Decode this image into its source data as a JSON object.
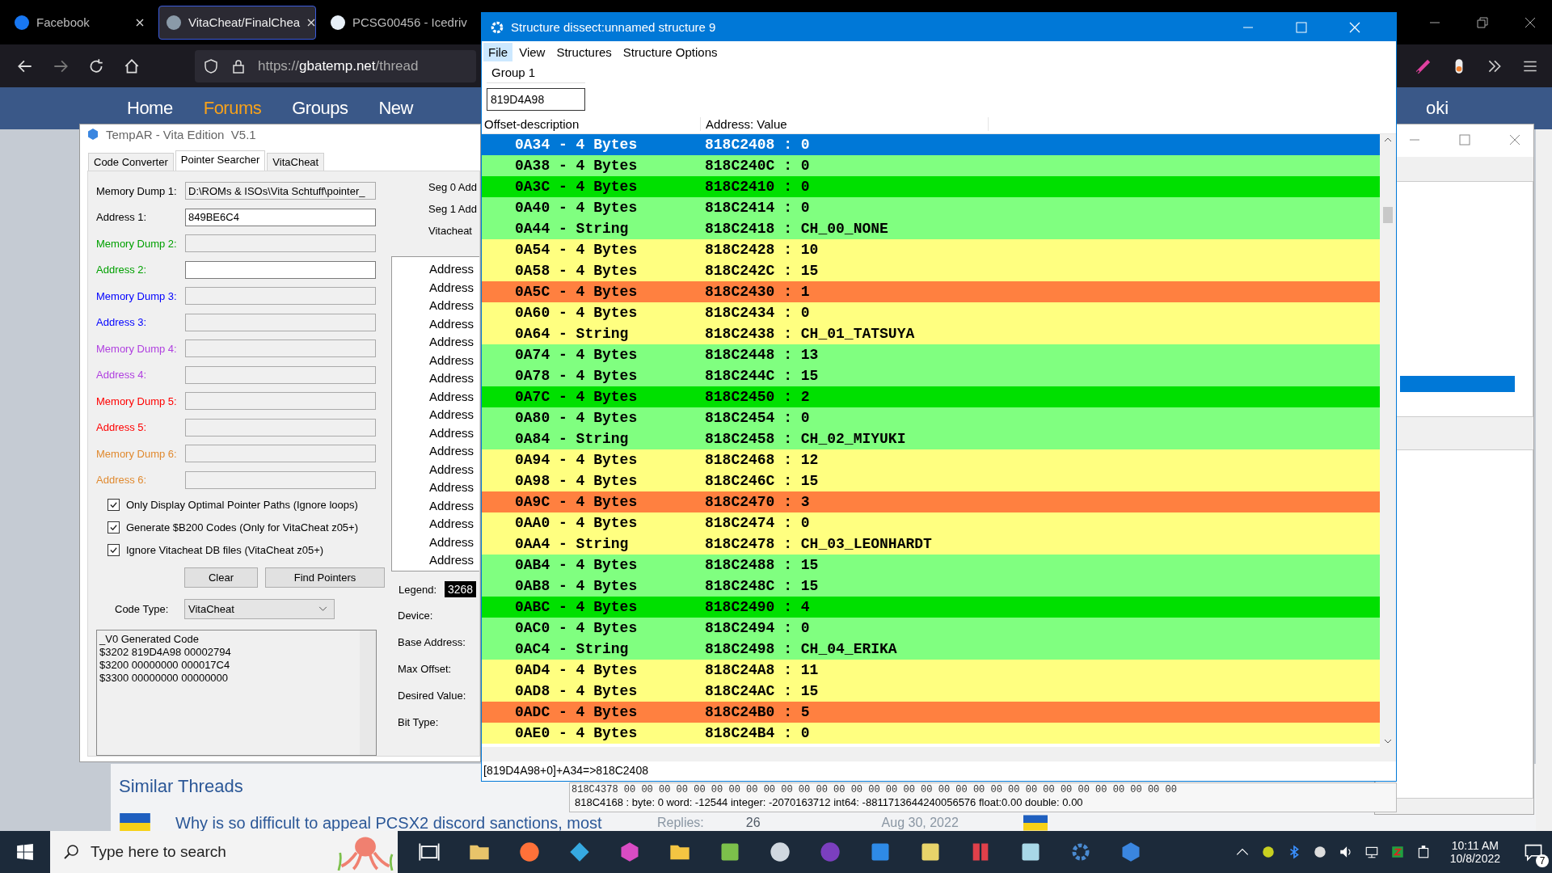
{
  "browser": {
    "tabs": [
      {
        "title": "Facebook",
        "selected": false
      },
      {
        "title": "VitaCheat/FinalChea",
        "selected": true
      },
      {
        "title": "PCSG00456 - Icedriv",
        "selected": false
      }
    ],
    "url_scheme": "https://",
    "url_host": "gbatemp.net",
    "url_path": "/thread",
    "nav": [
      {
        "label": "Home",
        "selected": false
      },
      {
        "label": "Forums",
        "selected": true
      },
      {
        "label": "Groups",
        "selected": false
      },
      {
        "label": "New",
        "selected": false
      }
    ],
    "nav_cut": "oki",
    "similar_title": "Similar Threads",
    "thread_title": "Why is so difficult to appeal PCSX2 discord sanctions, most",
    "replies_label": "Replies:",
    "replies": "26",
    "date": "Aug 30, 2022"
  },
  "tempar": {
    "title": "TempAR - Vita Edition  V5.1",
    "tabs": [
      {
        "label": "Code Converter",
        "selected": false
      },
      {
        "label": "Pointer Searcher",
        "selected": true
      },
      {
        "label": "VitaCheat",
        "selected": false
      }
    ],
    "fields": [
      {
        "label": "Memory Dump 1:",
        "value": "D:\\ROMs & ISOs\\Vita Schtuff\\pointer_",
        "enabled": false,
        "color": "#000000"
      },
      {
        "label": "Address 1:",
        "value": "849BE6C4",
        "enabled": true,
        "color": "#000000"
      },
      {
        "label": "Memory Dump 2:",
        "enabled": false,
        "color": "#00a000"
      },
      {
        "label": "Address 2:",
        "enabled": true,
        "color": "#00a000"
      },
      {
        "label": "Memory Dump 3:",
        "enabled": false,
        "color": "#0000ff"
      },
      {
        "label": "Address 3:",
        "enabled": false,
        "color": "#0000ff"
      },
      {
        "label": "Memory Dump 4:",
        "enabled": false,
        "color": "#b040e0"
      },
      {
        "label": "Address 4:",
        "enabled": false,
        "color": "#b040e0"
      },
      {
        "label": "Memory Dump 5:",
        "enabled": false,
        "color": "#ff0000"
      },
      {
        "label": "Address 5:",
        "enabled": false,
        "color": "#ff0000"
      },
      {
        "label": "Memory Dump 6:",
        "enabled": false,
        "color": "#e08a30"
      },
      {
        "label": "Address 6:",
        "enabled": false,
        "color": "#e08a30"
      }
    ],
    "options": [
      {
        "label": "Only Display Optimal Pointer Paths (Ignore loops)",
        "checked": true
      },
      {
        "label": "Generate $B200 Codes (Only for VitaCheat z05+)",
        "checked": true
      },
      {
        "label": "Ignore Vitacheat DB files (VitaCheat z05+)",
        "checked": true
      }
    ],
    "buttons": [
      "Clear",
      "Find Pointers"
    ],
    "code_type_label": "Code Type:",
    "code_type": "VitaCheat",
    "code_lines": [
      "_V0 Generated Code",
      "$3202 819D4A98 00002794",
      "$3200 00000000 000017C4",
      "$3300 00000000 00000000"
    ],
    "seg_labels": [
      "Seg 0 Add",
      "Seg 1 Add",
      "Vitacheat"
    ],
    "tree_items": [
      "Address",
      "Address",
      "Address",
      "Address",
      "Address",
      "Address",
      "Address",
      "Address",
      "Address",
      "Address",
      "Address",
      "Address",
      "Address",
      "Address",
      "Address",
      "Address",
      "Address"
    ],
    "legend_label": "Legend:",
    "legend_value": "3268",
    "settings": [
      "Device:",
      "Base Address:",
      "Max Offset:",
      "Desired Value:",
      "Bit Type:"
    ]
  },
  "dissect": {
    "title": "Structure dissect:unnamed structure 9",
    "menu": [
      {
        "label": "File",
        "selected": true
      },
      {
        "label": "View",
        "selected": false
      },
      {
        "label": "Structures",
        "selected": false
      },
      {
        "label": "Structure Options",
        "selected": false
      }
    ],
    "group_label": "Group 1",
    "group_address": "819D4A98",
    "columns": [
      "Offset-description",
      "Address: Value"
    ],
    "rows": [
      {
        "offset": "0A34 - 4 Bytes",
        "address_value": "818C2408 : 0",
        "selected": true
      },
      {
        "offset": "0A38 - 4 Bytes",
        "address_value": "818C240C : 0",
        "selected": false,
        "color": "#80ff80"
      },
      {
        "offset": "0A3C - 4 Bytes",
        "address_value": "818C2410 : 0",
        "selected": false,
        "color": "#00e000"
      },
      {
        "offset": "0A40 - 4 Bytes",
        "address_value": "818C2414 : 0",
        "selected": false,
        "color": "#80ff80"
      },
      {
        "offset": "0A44 - String",
        "address_value": "818C2418 : CH_00_NONE",
        "selected": false,
        "color": "#80ff80"
      },
      {
        "offset": "0A54 - 4 Bytes",
        "address_value": "818C2428 : 10",
        "selected": false,
        "color": "#ffff80"
      },
      {
        "offset": "0A58 - 4 Bytes",
        "address_value": "818C242C : 15",
        "selected": false,
        "color": "#ffff80"
      },
      {
        "offset": "0A5C - 4 Bytes",
        "address_value": "818C2430 : 1",
        "selected": false,
        "color": "#ff8040"
      },
      {
        "offset": "0A60 - 4 Bytes",
        "address_value": "818C2434 : 0",
        "selected": false,
        "color": "#ffff80"
      },
      {
        "offset": "0A64 - String",
        "address_value": "818C2438 : CH_01_TATSUYA",
        "selected": false,
        "color": "#ffff80"
      },
      {
        "offset": "0A74 - 4 Bytes",
        "address_value": "818C2448 : 13",
        "selected": false,
        "color": "#80ff80"
      },
      {
        "offset": "0A78 - 4 Bytes",
        "address_value": "818C244C : 15",
        "selected": false,
        "color": "#80ff80"
      },
      {
        "offset": "0A7C - 4 Bytes",
        "address_value": "818C2450 : 2",
        "selected": false,
        "color": "#00e000"
      },
      {
        "offset": "0A80 - 4 Bytes",
        "address_value": "818C2454 : 0",
        "selected": false,
        "color": "#80ff80"
      },
      {
        "offset": "0A84 - String",
        "address_value": "818C2458 : CH_02_MIYUKI",
        "selected": false,
        "color": "#80ff80"
      },
      {
        "offset": "0A94 - 4 Bytes",
        "address_value": "818C2468 : 12",
        "selected": false,
        "color": "#ffff80"
      },
      {
        "offset": "0A98 - 4 Bytes",
        "address_value": "818C246C : 15",
        "selected": false,
        "color": "#ffff80"
      },
      {
        "offset": "0A9C - 4 Bytes",
        "address_value": "818C2470 : 3",
        "selected": false,
        "color": "#ff8040"
      },
      {
        "offset": "0AA0 - 4 Bytes",
        "address_value": "818C2474 : 0",
        "selected": false,
        "color": "#ffff80"
      },
      {
        "offset": "0AA4 - String",
        "address_value": "818C2478 : CH_03_LEONHARDT",
        "selected": false,
        "color": "#ffff80"
      },
      {
        "offset": "0AB4 - 4 Bytes",
        "address_value": "818C2488 : 15",
        "selected": false,
        "color": "#80ff80"
      },
      {
        "offset": "0AB8 - 4 Bytes",
        "address_value": "818C248C : 15",
        "selected": false,
        "color": "#80ff80"
      },
      {
        "offset": "0ABC - 4 Bytes",
        "address_value": "818C2490 : 4",
        "selected": false,
        "color": "#00e000"
      },
      {
        "offset": "0AC0 - 4 Bytes",
        "address_value": "818C2494 : 0",
        "selected": false,
        "color": "#80ff80"
      },
      {
        "offset": "0AC4 - String",
        "address_value": "818C2498 : CH_04_ERIKA",
        "selected": false,
        "color": "#80ff80"
      },
      {
        "offset": "0AD4 - 4 Bytes",
        "address_value": "818C24A8 : 11",
        "selected": false,
        "color": "#ffff80"
      },
      {
        "offset": "0AD8 - 4 Bytes",
        "address_value": "818C24AC : 15",
        "selected": false,
        "color": "#ffff80"
      },
      {
        "offset": "0ADC - 4 Bytes",
        "address_value": "818C24B0 : 5",
        "selected": false,
        "color": "#ff8040"
      },
      {
        "offset": "0AE0 - 4 Bytes",
        "address_value": "818C24B4 : 0",
        "selected": false,
        "color": "#ffff80"
      }
    ],
    "status": "[819D4A98+0]+A34=>818C2408"
  },
  "memory_view": {
    "hex_line": "818C4378  00 00 00 00 00 00 00 00 00 00 00 00 00 00 00 00  00 00 00 00 00 00 00 00 00 00 00 00 00 00 00 00",
    "status": "818C4168 : byte: 0 word: -12544 integer: -2070163712 int64: -8811713644240056576 float:0.00 double: 0.00"
  },
  "taskbar": {
    "search_placeholder": "Type here to search",
    "time": "10:11 AM",
    "date": "10/8/2022",
    "notifications": "7"
  }
}
